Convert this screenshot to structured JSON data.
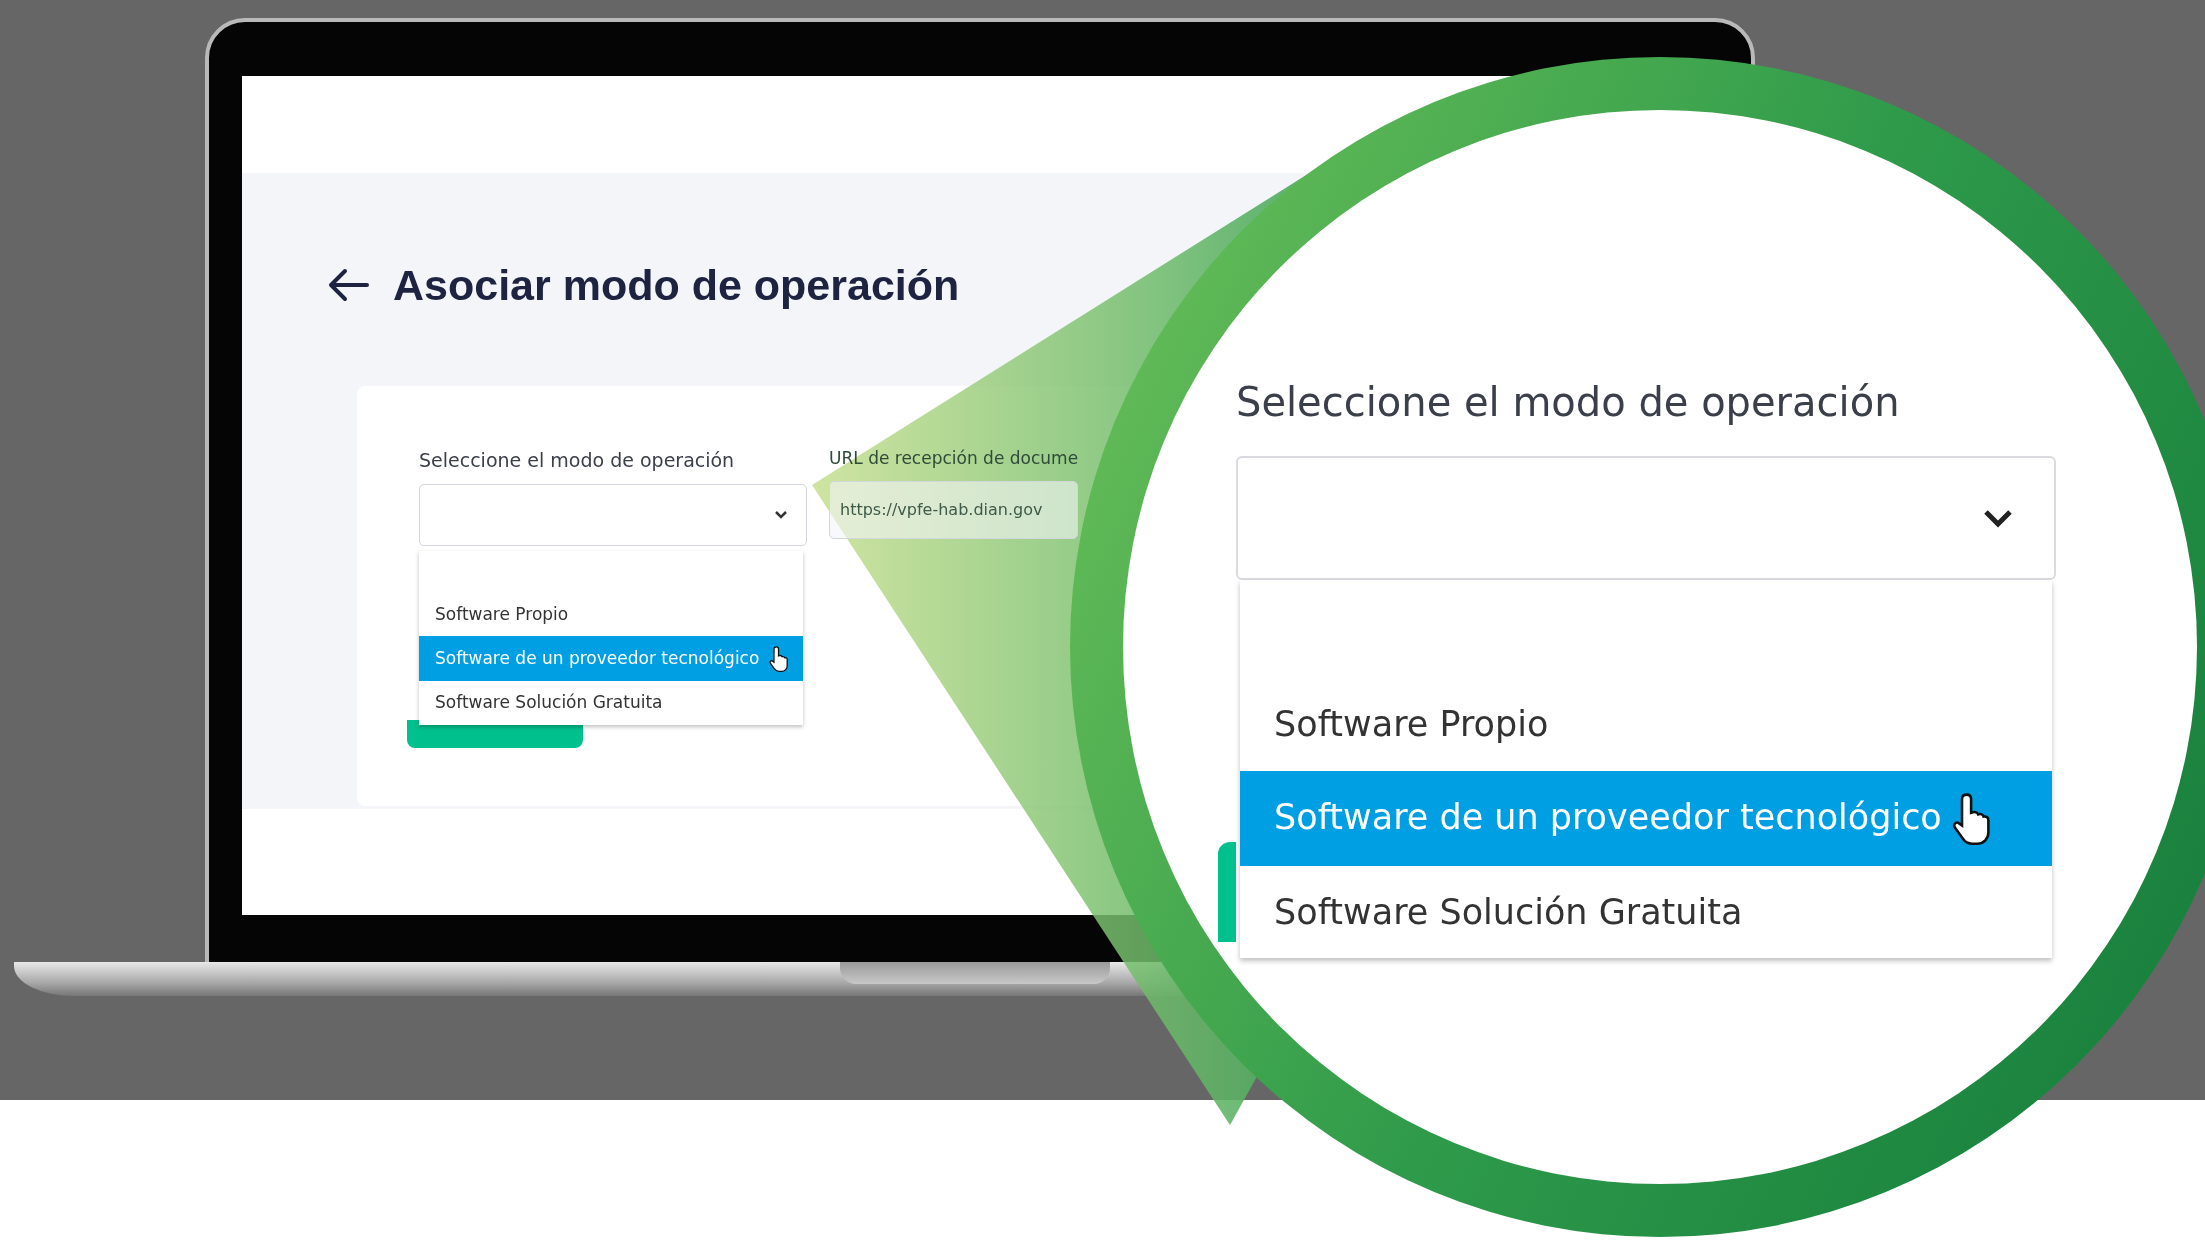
{
  "page": {
    "title": "Asociar modo de operación"
  },
  "form": {
    "mode_field": {
      "label": "Seleccione el modo de operación",
      "options": [
        {
          "label": "Software Propio",
          "selected": false
        },
        {
          "label": "Software de un proveedor tecnológico",
          "selected": true
        },
        {
          "label": "Software Solución Gratuita",
          "selected": false
        }
      ]
    },
    "url_field": {
      "label": "URL de recepción de docume",
      "value": "https://vpfe-hab.dian.gov"
    }
  },
  "magnifier": {
    "label": "Seleccione el modo de operación",
    "options": [
      {
        "label": "Software Propio",
        "selected": false
      },
      {
        "label": "Software de un proveedor tecnológico",
        "selected": true
      },
      {
        "label": "Software Solución Gratuita",
        "selected": false
      }
    ]
  }
}
